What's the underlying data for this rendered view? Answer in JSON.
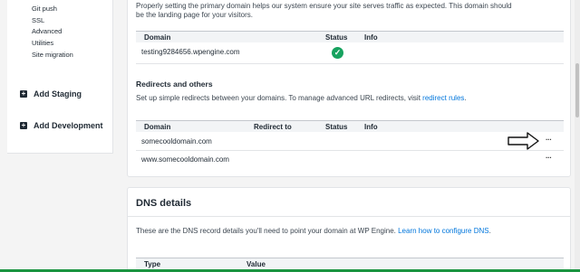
{
  "sidebar": {
    "sub_items": [
      "Git push",
      "SSL",
      "Advanced",
      "Utilities",
      "Site migration"
    ],
    "env_items": [
      "Add Staging",
      "Add Development"
    ]
  },
  "primary_domain": {
    "intro_line1": "Properly setting the primary domain helps our system ensure your site serves traffic as expected. This domain should",
    "intro_line2": "be the landing page for your visitors.",
    "headers": {
      "domain": "Domain",
      "status": "Status",
      "info": "Info"
    },
    "row": {
      "domain": "testing9284656.wpengine.com",
      "status_icon": "check-circle-icon"
    }
  },
  "redirects": {
    "title": "Redirects and others",
    "desc": "Set up simple redirects between your domains. To manage advanced URL redirects, visit",
    "link": "redirect rules",
    "period": ".",
    "headers": {
      "domain": "Domain",
      "redirect_to": "Redirect to",
      "status": "Status",
      "info": "Info"
    },
    "rows": [
      {
        "domain": "somecooldomain.com",
        "menu": "···"
      },
      {
        "domain": "www.somecooldomain.com",
        "menu": "···"
      }
    ]
  },
  "dns": {
    "title": "DNS details",
    "desc": "These are the DNS record details you'll need to point your domain at WP Engine.",
    "link": "Learn how to configure DNS",
    "period": ".",
    "headers": {
      "type": "Type",
      "value": "Value"
    }
  },
  "colors": {
    "accent_link": "#0076dc",
    "status_green": "#17a25f",
    "bottom_bar": "#1a9440"
  }
}
